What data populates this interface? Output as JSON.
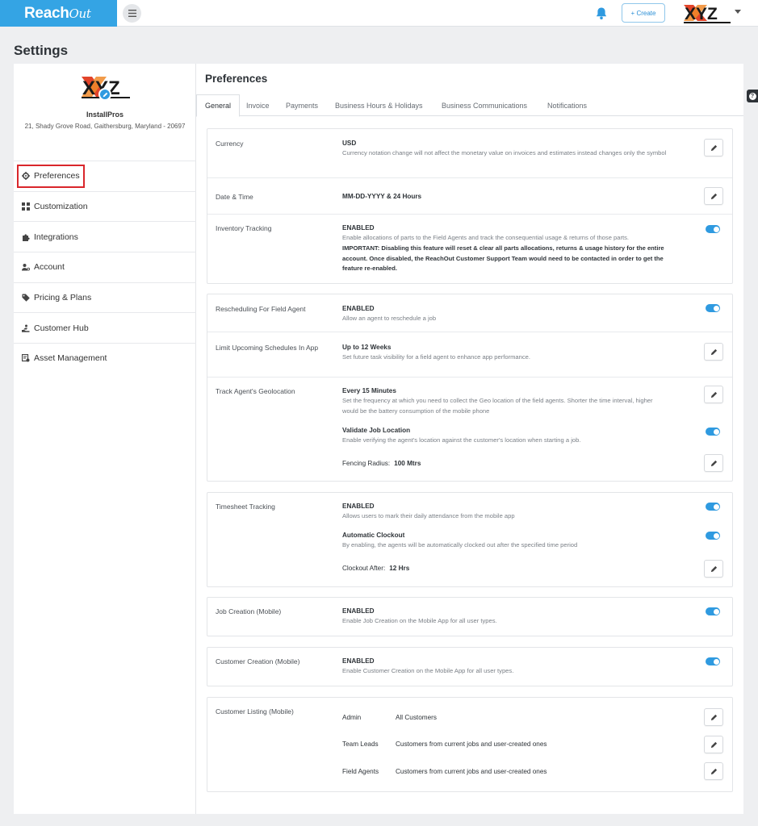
{
  "app": {
    "brand": "Reach",
    "brand_suffix": "Out",
    "create_label": "+ Create",
    "logo_text": "XYZ",
    "help_glyph": "?"
  },
  "colors": {
    "brand": "#34a4e4",
    "accent": "#2f9ae0",
    "highlight": "#d9262b"
  },
  "icons": [
    "menu-icon",
    "bell-icon",
    "pencil-icon",
    "gear-icon",
    "grid-icon",
    "puzzle-icon",
    "user-settings-icon",
    "tag-icon",
    "hand-icon",
    "asset-icon",
    "question-icon",
    "caret-down-icon"
  ],
  "page": {
    "title": "Settings"
  },
  "org": {
    "name": "InstallPros",
    "address": "21, Shady Grove Road, Gaithersburg, Maryland - 20697"
  },
  "sidebar": {
    "items": [
      {
        "label": "Preferences",
        "icon": "gear-icon",
        "active": true
      },
      {
        "label": "Customization",
        "icon": "grid-icon"
      },
      {
        "label": "Integrations",
        "icon": "puzzle-icon"
      },
      {
        "label": "Account",
        "icon": "user-settings-icon"
      },
      {
        "label": "Pricing & Plans",
        "icon": "tag-icon"
      },
      {
        "label": "Customer Hub",
        "icon": "hand-icon"
      },
      {
        "label": "Asset Management",
        "icon": "asset-icon"
      }
    ]
  },
  "main": {
    "title": "Preferences",
    "tabs": [
      {
        "label": "General",
        "active": true
      },
      {
        "label": "Invoice"
      },
      {
        "label": "Payments"
      },
      {
        "label": "Business Hours & Holidays"
      },
      {
        "label": "Business Communications"
      },
      {
        "label": "Notifications"
      }
    ],
    "currency": {
      "label": "Currency",
      "value": "USD",
      "desc": "Currency notation change will not affect the monetary value on invoices and estimates instead changes only the symbol"
    },
    "datetime": {
      "label": "Date & Time",
      "value": "MM-DD-YYYY & 24 Hours"
    },
    "inventory": {
      "label": "Inventory Tracking",
      "value": "ENABLED",
      "enabled": true,
      "desc": "Enable allocations of parts to the Field Agents and track the consequential usage & returns of those parts.",
      "warning": "IMPORTANT: Disabling this feature will reset & clear all parts allocations, returns & usage history for the entire account. Once disabled, the ReachOut Customer Support Team would need to be contacted in order to get the feature re-enabled."
    },
    "rescheduling": {
      "label": "Rescheduling For Field Agent",
      "value": "ENABLED",
      "enabled": true,
      "desc": "Allow an agent to reschedule a job"
    },
    "limit_schedules": {
      "label": "Limit Upcoming Schedules In App",
      "value": "Up to 12 Weeks",
      "desc": "Set future task visibility for a field agent to enhance app performance."
    },
    "geolocation": {
      "label": "Track Agent's Geolocation",
      "value": "Every 15 Minutes",
      "desc": "Set the frequency at which you need to collect the Geo location of the field agents. Shorter the time interval, higher would be the battery consumption of the mobile phone",
      "validate_title": "Validate Job Location",
      "validate_enabled": true,
      "validate_desc": "Enable verifying the agent's location against the customer's location when starting a job.",
      "fencing_label": "Fencing Radius:",
      "fencing_value": "100 Mtrs"
    },
    "timesheet": {
      "label": "Timesheet Tracking",
      "value": "ENABLED",
      "enabled": true,
      "desc": "Allows users to mark their daily attendance from the mobile app",
      "auto_title": "Automatic Clockout",
      "auto_enabled": true,
      "auto_desc": "By enabling, the agents will be automatically clocked out after the specified time period",
      "clockout_label": "Clockout After:",
      "clockout_value": "12 Hrs"
    },
    "job_creation": {
      "label": "Job Creation (Mobile)",
      "value": "ENABLED",
      "enabled": true,
      "desc": "Enable Job Creation on the Mobile App for all user types."
    },
    "customer_creation": {
      "label": "Customer Creation (Mobile)",
      "value": "ENABLED",
      "enabled": true,
      "desc": "Enable Customer Creation on the Mobile App for all user types."
    },
    "customer_listing": {
      "label": "Customer Listing (Mobile)",
      "rows": [
        {
          "role": "Admin",
          "value": "All Customers"
        },
        {
          "role": "Team Leads",
          "value": "Customers from current jobs and user-created ones"
        },
        {
          "role": "Field Agents",
          "value": "Customers from current jobs and user-created ones"
        }
      ]
    }
  }
}
